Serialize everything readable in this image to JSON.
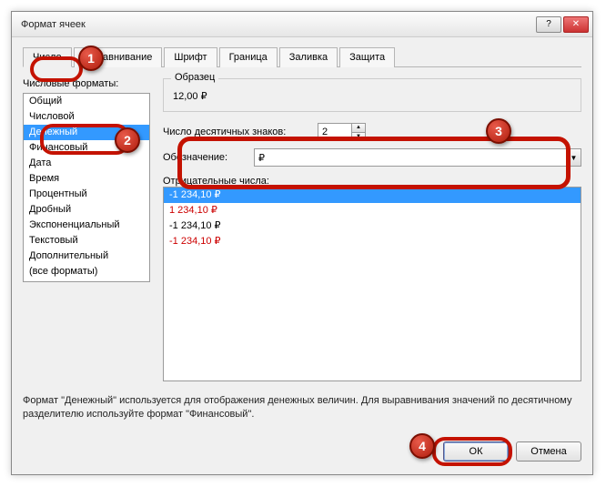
{
  "window": {
    "title": "Формат ячеек"
  },
  "tabs": [
    "Число",
    "Выравнивание",
    "Шрифт",
    "Граница",
    "Заливка",
    "Защита"
  ],
  "active_tab": 0,
  "left": {
    "label": "Числовые форматы:",
    "items": [
      "Общий",
      "Числовой",
      "Денежный",
      "Финансовый",
      "Дата",
      "Время",
      "Процентный",
      "Дробный",
      "Экспоненциальный",
      "Текстовый",
      "Дополнительный",
      "(все форматы)"
    ],
    "selected_index": 2
  },
  "sample": {
    "label": "Образец",
    "value": "12,00 ₽"
  },
  "decimals": {
    "label": "Число десятичных знаков:",
    "value": "2"
  },
  "symbol": {
    "label": "Обозначение:",
    "value": "₽"
  },
  "negative": {
    "label": "Отрицательные числа:",
    "items": [
      {
        "text": "-1 234,10 ₽",
        "color": "#000",
        "selected": true
      },
      {
        "text": "1 234,10 ₽",
        "color": "#c00"
      },
      {
        "text": "-1 234,10 ₽",
        "color": "#000"
      },
      {
        "text": "-1 234,10 ₽",
        "color": "#c00"
      }
    ]
  },
  "description": "Формат \"Денежный\" используется для отображения денежных величин. Для выравнивания значений по десятичному разделителю используйте формат \"Финансовый\".",
  "buttons": {
    "ok": "ОК",
    "cancel": "Отмена"
  },
  "callouts": [
    "1",
    "2",
    "3",
    "4"
  ]
}
